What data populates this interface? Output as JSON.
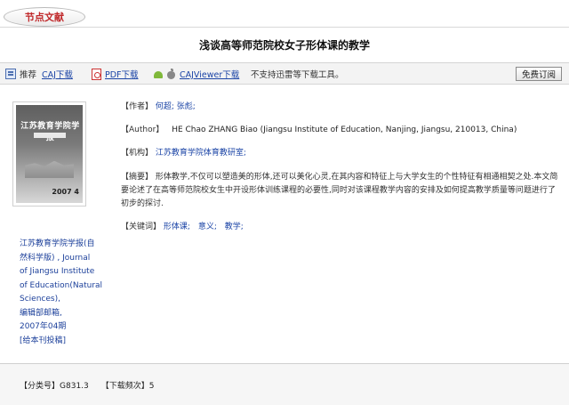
{
  "header": {
    "tag": "节点文献",
    "title": "浅谈高等师范院校女子形体课的教学"
  },
  "toolbar": {
    "recommend": "推荐",
    "caj_download": "CAJ下载",
    "pdf_download": "PDF下载",
    "cajviewer_download": "CAJViewer下载",
    "notice": "不支持迅雷等下载工具。",
    "free_order": "免费订阅"
  },
  "cover": {
    "title": "江苏教育学院学报",
    "issue": "2007 4"
  },
  "journal": {
    "lines": [
      "江苏教育学院学报(自",
      "然科学版) , Journal",
      "of Jiangsu Institute",
      "of Education(Natural",
      "Sciences),",
      "编辑部邮箱,",
      "2007年04期",
      "[给本刊投稿]"
    ]
  },
  "article": {
    "author_label": "【作者】",
    "authors": "何超;  张彪;",
    "author_en_label": "【Author】",
    "author_en": "HE Chao ZHANG Biao (Jiangsu Institute of Education, Nanjing, Jiangsu, 210013, China)",
    "institution_label": "【机构】",
    "institution": "江苏教育学院体育教研室;",
    "abstract_label": "【摘要】",
    "abstract": "形体教学,不仅可以塑造美的形体,还可以美化心灵,在其内容和特征上与大学女生的个性特征有相通相契之处.本文简要论述了在高等师范院校女生中开设形体训练课程的必要性,同时对该课程教学内容的安排及如何提高教学质量等问题进行了初步的探讨.",
    "keywords_label": "【关键词】",
    "keywords": [
      "形体课;",
      "意义;",
      "教学;"
    ]
  },
  "footer": {
    "classno_label": "【分类号】",
    "classno": "G831.3",
    "downloads_label": "【下载频次】",
    "downloads": "5"
  }
}
